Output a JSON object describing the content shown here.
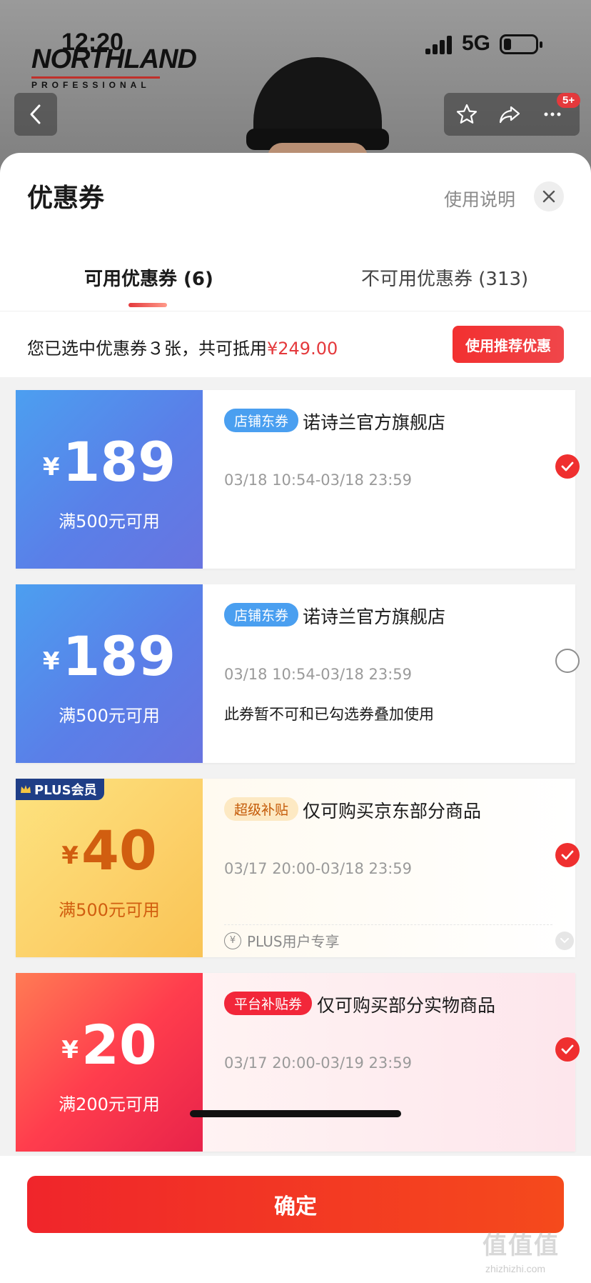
{
  "status_bar": {
    "time": "12:20",
    "network": "5G"
  },
  "brand": {
    "name": "NORTHLAND",
    "sub": "PROFESSIONAL"
  },
  "nav": {
    "badge": "5+"
  },
  "sheet": {
    "title": "优惠券",
    "help_label": "使用说明",
    "tabs": [
      {
        "label": "可用优惠券 (6)",
        "active": true
      },
      {
        "label": "不可用优惠券 (313)",
        "active": false
      }
    ],
    "summary": {
      "prefix": "您已选中优惠券３张，共可抵用",
      "amount": "¥249.00"
    },
    "recommend_label": "使用推荐优惠",
    "coupons": [
      {
        "style": "blue",
        "currency": "¥",
        "amount": "189",
        "condition": "满500元可用",
        "tag": "店铺东券",
        "title": "诺诗兰官方旗舰店",
        "validity": "03/18 10:54-03/18 23:59",
        "note": "",
        "checked": true
      },
      {
        "style": "blue",
        "currency": "¥",
        "amount": "189",
        "condition": "满500元可用",
        "tag": "店铺东券",
        "title": "诺诗兰官方旗舰店",
        "validity": "03/18 10:54-03/18 23:59",
        "note": "此券暂不可和已勾选券叠加使用",
        "checked": false
      },
      {
        "style": "gold",
        "currency": "¥",
        "amount": "40",
        "condition": "满500元可用",
        "tag": "超级补贴",
        "title": "仅可购买京东部分商品",
        "validity": "03/17 20:00-03/18 23:59",
        "note": "",
        "checked": true,
        "badge": "PLUS会员",
        "footer": "PLUS用户专享"
      },
      {
        "style": "red",
        "currency": "¥",
        "amount": "20",
        "condition": "满200元可用",
        "tag": "平台补贴券",
        "title": "仅可购买部分实物商品",
        "validity": "03/17 20:00-03/19 23:59",
        "note": "",
        "checked": true
      }
    ],
    "confirm_label": "确定"
  },
  "watermark": {
    "text": "值值值",
    "sub": "zhizhizhi.com"
  },
  "colors": {
    "accent": "#e4393c",
    "blue": "#5a7fe8",
    "gold": "#fcd16a"
  }
}
